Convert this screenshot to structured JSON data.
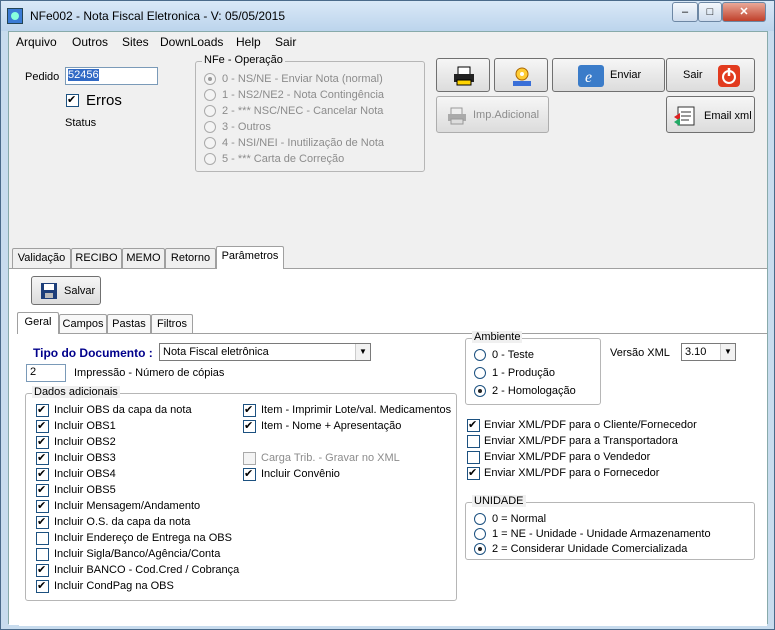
{
  "window": {
    "title": "NFe002 - Nota Fiscal Eletronica - V: 05/05/2015",
    "min": "–",
    "max": "□",
    "close": "✕"
  },
  "menu": [
    {
      "label": "Arquivo"
    },
    {
      "label": "Outros"
    },
    {
      "label": "Sites"
    },
    {
      "label": "DownLoads"
    },
    {
      "label": "Help"
    },
    {
      "label": "Sair"
    }
  ],
  "order": {
    "label": "Pedido",
    "value": "52456",
    "errors_label": "Erros",
    "status_label": "Status"
  },
  "operation": {
    "title": "NFe - Operação",
    "options": [
      "0 - NS/NE - Enviar Nota (normal)",
      "1 - NS2/NE2 - Nota Contingência",
      "2 - *** NSC/NEC - Cancelar Nota",
      "3 - Outros",
      "4 - NSI/NEI - Inutilização de Nota",
      "5 - *** Carta de Correção"
    ]
  },
  "buttons": {
    "enviar": "Enviar",
    "sair": "Sair",
    "imp_adicional": "Imp.Adicional",
    "email_xml": "Email xml",
    "salvar": "Salvar"
  },
  "main_tabs": [
    {
      "label": "Validação"
    },
    {
      "label": "RECIBO"
    },
    {
      "label": "MEMO"
    },
    {
      "label": "Retorno"
    },
    {
      "label": "Parâmetros"
    }
  ],
  "sub_tabs": [
    {
      "label": "Geral"
    },
    {
      "label": "Campos"
    },
    {
      "label": "Pastas"
    },
    {
      "label": "Filtros"
    }
  ],
  "doc": {
    "label": "Tipo do Documento :",
    "value": "Nota Fiscal eletrônica",
    "copies": "2",
    "copies_label": "Impressão - Número de cópias"
  },
  "dados": {
    "title": "Dados adicionais",
    "left": [
      {
        "label": "Incluir OBS da capa da nota",
        "checked": true
      },
      {
        "label": "Incluir OBS1",
        "checked": true
      },
      {
        "label": "Incluir OBS2",
        "checked": true
      },
      {
        "label": "Incluir OBS3",
        "checked": true
      },
      {
        "label": "Incluir OBS4",
        "checked": true
      },
      {
        "label": "Incluir OBS5",
        "checked": true
      },
      {
        "label": "Incluir Mensagem/Andamento",
        "checked": true
      },
      {
        "label": "Incluir O.S. da capa da nota",
        "checked": true
      },
      {
        "label": "Incluir Endereço de Entrega na OBS",
        "checked": false
      },
      {
        "label": "Incluir Sigla/Banco/Agência/Conta",
        "checked": false
      },
      {
        "label": "Incluir BANCO - Cod.Cred / Cobrança",
        "checked": true
      },
      {
        "label": "Incluir CondPag na OBS",
        "checked": true
      }
    ],
    "right": [
      {
        "label": "Item - Imprimir Lote/val. Medicamentos",
        "checked": true
      },
      {
        "label": "Item - Nome + Apresentação",
        "checked": true
      },
      {
        "label": "Carga Trib. - Gravar no XML",
        "checked": false
      },
      {
        "label": "Incluir Convênio",
        "checked": true
      }
    ]
  },
  "ambiente": {
    "title": "Ambiente",
    "options": [
      "0 - Teste",
      "1 - Produção",
      "2 - Homologação"
    ],
    "selected": 2,
    "versao_label": "Versão XML",
    "versao_value": "3.10"
  },
  "enviar_xml": [
    {
      "label": "Enviar XML/PDF para o Cliente/Fornecedor",
      "checked": true
    },
    {
      "label": "Enviar XML/PDF para a Transportadora",
      "checked": false
    },
    {
      "label": "Enviar XML/PDF para o Vendedor",
      "checked": false
    },
    {
      "label": "Enviar XML/PDF para o Fornecedor",
      "checked": true
    }
  ],
  "unidade": {
    "title": "UNIDADE",
    "options": [
      "0 = Normal",
      "1 = NE - Unidade - Unidade Armazenamento",
      "2 = Considerar Unidade Comercializada"
    ],
    "selected": 2
  }
}
